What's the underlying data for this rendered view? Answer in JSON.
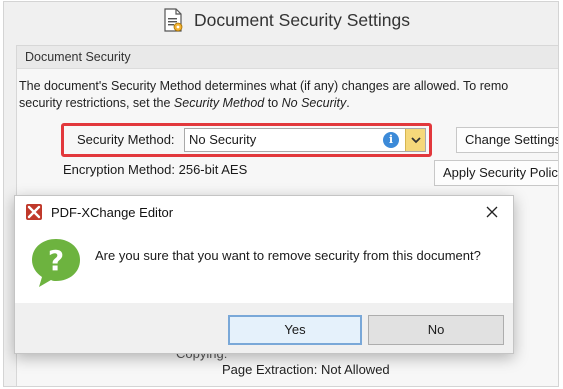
{
  "window": {
    "title": "Document Security Settings"
  },
  "security_group": {
    "header": "Document Security",
    "description_line1": "The document's Security Method determines what (if any) changes are allowed. To remo",
    "description_line2_prefix": "security restrictions, set the ",
    "description_line2_em1": "Security Method",
    "description_line2_mid": " to ",
    "description_line2_em2": "No Security",
    "description_line2_suffix": ".",
    "security_method_label": "Security Method:",
    "security_method_value": "No Security",
    "encryption_label": "Encryption Method:  256-bit AES",
    "change_settings_button": "Change Settings",
    "apply_policy_button": "Apply Security Policy"
  },
  "background_rows": {
    "faded_text": "Copying:",
    "page_extraction": "Page Extraction:  Not Allowed"
  },
  "dialog": {
    "app_name": "PDF-XChange Editor",
    "message": "Are you sure that you want to remove security from this document?",
    "yes_label": "Yes",
    "no_label": "No"
  },
  "colors": {
    "highlight": "#e2383c",
    "info_icon": "#3c8ad8",
    "dropdown_arrow_bg": "#f5d87a",
    "question_icon": "#6db33f",
    "app_icon": "#c0392b"
  },
  "icons": {
    "title": "document-settings-icon",
    "info": "info-icon",
    "dropdown": "chevron-down-icon",
    "app": "pdf-xchange-icon",
    "close": "close-icon",
    "question": "question-bubble-icon"
  }
}
